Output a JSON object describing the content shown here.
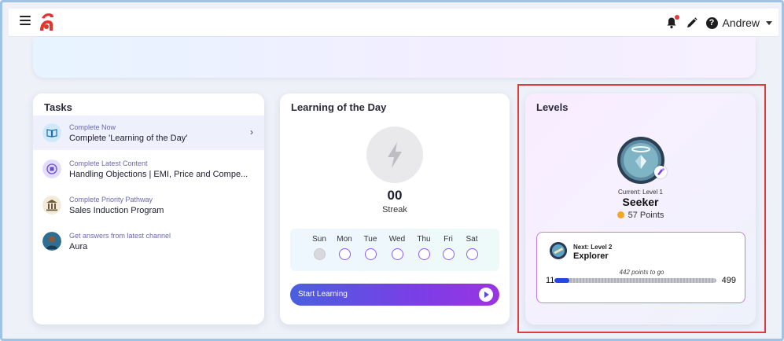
{
  "header": {
    "user_name": "Andrew"
  },
  "tasks": {
    "title": "Tasks",
    "items": [
      {
        "subtitle": "Complete Now",
        "label": "Complete 'Learning of the Day'",
        "icon": "book-icon"
      },
      {
        "subtitle": "Complete Latest Content",
        "label": "Handling Objections | EMI, Price and Compe...",
        "icon": "content-icon"
      },
      {
        "subtitle": "Complete Priority Pathway",
        "label": "Sales Induction Program",
        "icon": "institution-icon"
      },
      {
        "subtitle": "Get answers from latest channel",
        "label": "Aura",
        "icon": "avatar-icon"
      }
    ]
  },
  "lotd": {
    "title": "Learning of the Day",
    "streak_count": "00",
    "streak_label": "Streak",
    "days": [
      "Sun",
      "Mon",
      "Tue",
      "Wed",
      "Thu",
      "Fri",
      "Sat"
    ],
    "start_label": "Start Learning"
  },
  "levels": {
    "title": "Levels",
    "current_level": "Current: Level 1",
    "current_name": "Seeker",
    "points": "57 Points",
    "next_level": "Next: Level 2",
    "next_name": "Explorer",
    "points_to_go": "442 points to go",
    "progress_min": "11",
    "progress_max": "499",
    "progress_value": 57
  },
  "colors": {
    "accent_purple": "#8b5cf6",
    "progress_blue": "#2446e6",
    "highlight_red": "#e23b3b",
    "logo_red": "#e3342f"
  }
}
